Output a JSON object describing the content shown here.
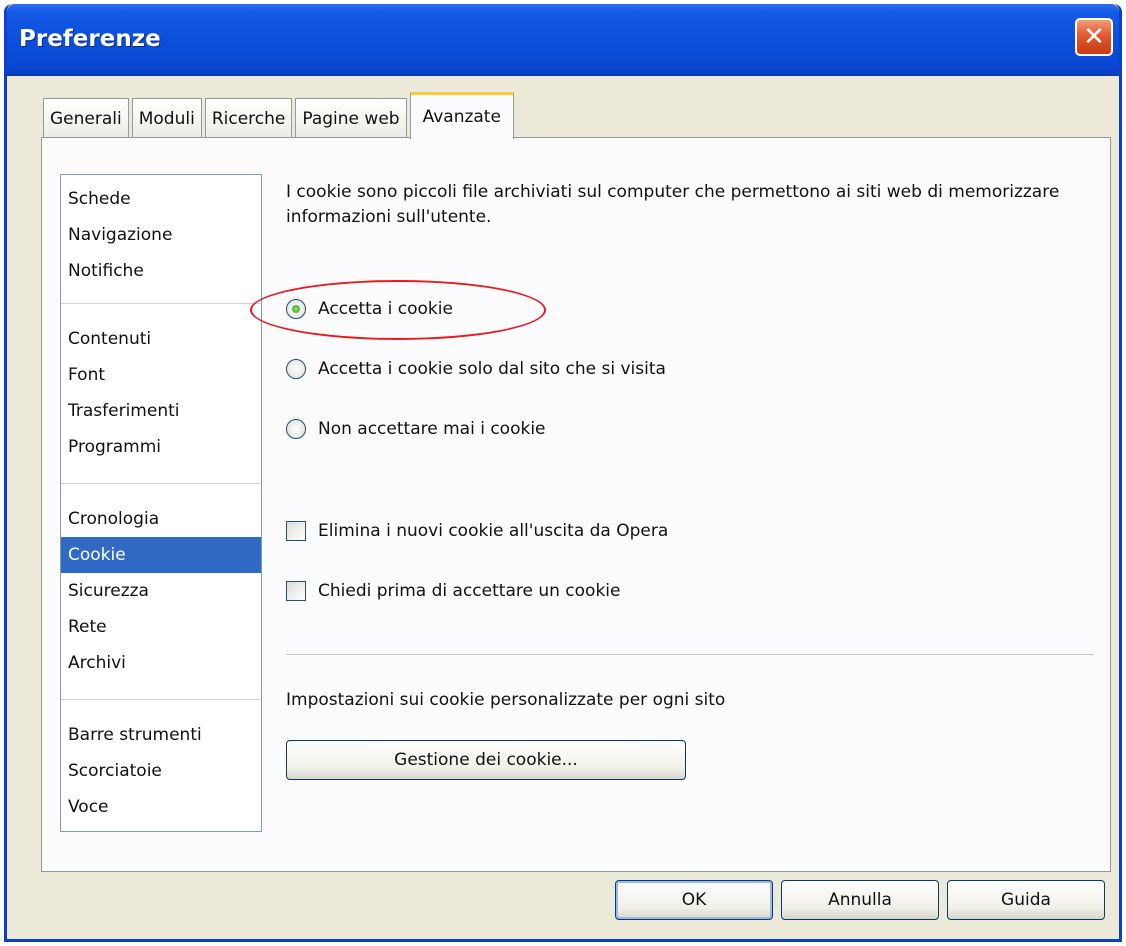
{
  "window": {
    "title": "Preferenze"
  },
  "tabs": [
    {
      "label": "Generali"
    },
    {
      "label": "Moduli"
    },
    {
      "label": "Ricerche"
    },
    {
      "label": "Pagine web"
    },
    {
      "label": "Avanzate"
    }
  ],
  "sidebar": {
    "groups": [
      [
        "Schede",
        "Navigazione",
        "Notifiche"
      ],
      [
        "Contenuti",
        "Font",
        "Trasferimenti",
        "Programmi"
      ],
      [
        "Cronologia",
        "Cookie",
        "Sicurezza",
        "Rete",
        "Archivi"
      ],
      [
        "Barre strumenti",
        "Scorciatoie",
        "Voce"
      ]
    ],
    "selected": "Cookie"
  },
  "cookies": {
    "description": "I cookie sono piccoli file archiviati sul computer che permettono ai siti web di memorizzare informazioni sull'utente.",
    "radio_accept": "Accetta i cookie",
    "radio_site_only": "Accetta i cookie solo dal sito che si visita",
    "radio_never": "Non accettare mai i cookie",
    "selected_radio": "Accetta i cookie",
    "check_delete_on_exit": "Elimina i nuovi cookie all'uscita da Opera",
    "check_ask_first": "Chiedi prima di accettare un cookie",
    "per_site_label": "Impostazioni sui cookie personalizzate per ogni sito",
    "manage_button": "Gestione dei cookie..."
  },
  "footer": {
    "ok": "OK",
    "cancel": "Annulla",
    "help": "Guida"
  },
  "colors": {
    "titlebar": "#0a47d0",
    "selection": "#316ac5",
    "highlight_ellipse": "#e81b20",
    "active_tab_accent": "#ffc83c"
  }
}
